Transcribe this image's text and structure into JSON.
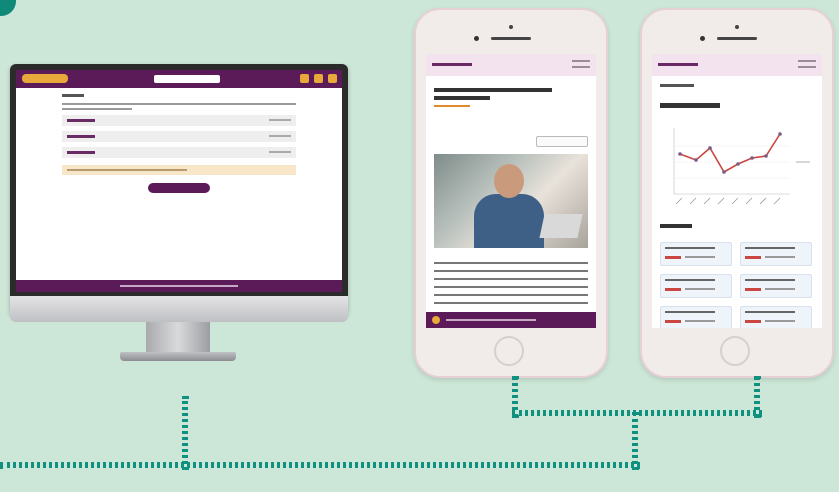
{
  "colors": {
    "background": "#cce6d7",
    "brand_purple": "#5b1b59",
    "accent_orange": "#e9a93a",
    "connector_teal": "#10907e"
  },
  "monitor": {
    "rows": 3,
    "has_notice_banner": true,
    "has_primary_button": true
  },
  "phone_left": {
    "has_photo": true,
    "has_audio_bar": true
  },
  "phone_right": {
    "chart_type": "line",
    "stat_cards": 6
  }
}
